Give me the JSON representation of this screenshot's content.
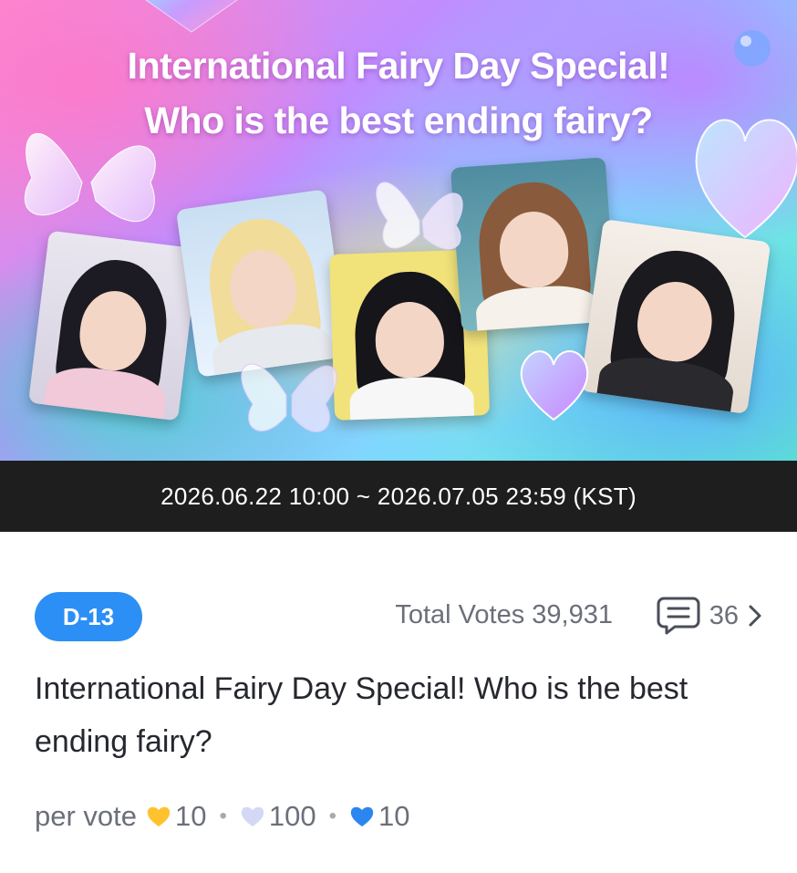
{
  "banner": {
    "title_line1": "International Fairy Day Special!",
    "title_line2": "Who is the best ending fairy?"
  },
  "period": "2026.06.22 10:00 ~ 2026.07.05 23:59 (KST)",
  "meta": {
    "d_day": "D-13",
    "total_votes_label": "Total Votes",
    "total_votes": "39,931",
    "comments_count": "36",
    "icons": [
      "comment-icon",
      "chevron-right-icon"
    ]
  },
  "vote_title": "International Fairy Day Special! Who is the best ending fairy?",
  "per_vote": {
    "label": "per vote",
    "items": [
      {
        "icon": "gold-heart-icon",
        "color": "#ffc22e",
        "value": "10"
      },
      {
        "icon": "lavender-heart-icon",
        "color": "#d4d8f5",
        "value": "100"
      },
      {
        "icon": "blue-heart-icon",
        "color": "#2b86f0",
        "value": "10"
      }
    ]
  },
  "colors": {
    "accent": "#2b8ff5",
    "date_bar": "#1e1e1e",
    "muted_text": "#6b6f7a"
  }
}
